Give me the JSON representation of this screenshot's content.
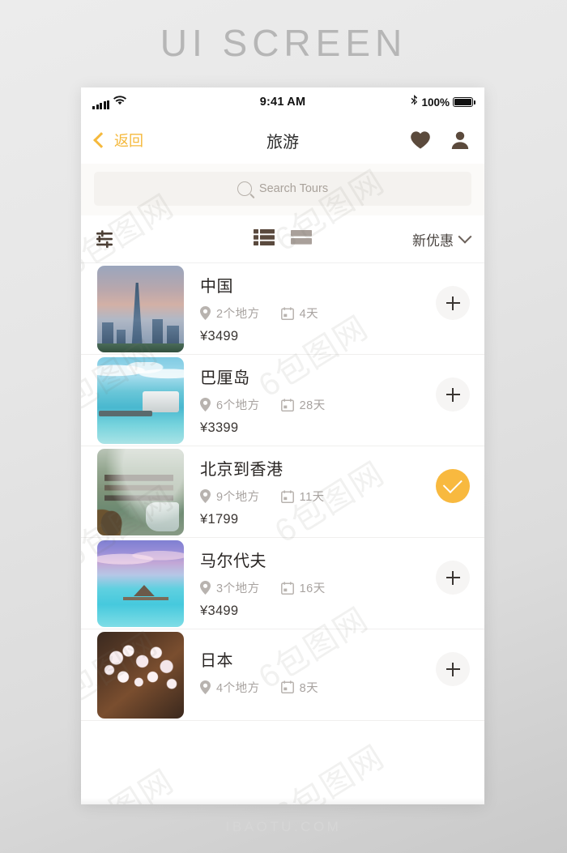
{
  "poster": {
    "title": "UI SCREEN",
    "site_watermark": "IBAOTU.COM",
    "watermark_text": "6包图网",
    "accent_color": "#f5b93c",
    "text_color": "#2a2624"
  },
  "status_bar": {
    "time": "9:41 AM",
    "battery_percent": "100%",
    "signal_icon": "signal-bars-icon",
    "wifi_icon": "wifi-icon",
    "bluetooth_icon": "bluetooth-icon",
    "battery_icon": "battery-full-icon"
  },
  "nav_bar": {
    "back_label": "返回",
    "back_icon": "chevron-left-icon",
    "title": "旅游",
    "favorite_icon": "heart-icon",
    "profile_icon": "person-icon"
  },
  "search": {
    "placeholder": "Search Tours",
    "value": "",
    "icon": "search-icon"
  },
  "filter_bar": {
    "filter_icon": "sliders-filter-icon",
    "views": [
      {
        "name": "list-view",
        "icon": "list-view-icon",
        "active": true
      },
      {
        "name": "card-view",
        "icon": "card-view-icon",
        "active": false
      }
    ],
    "sort_label": "新优惠",
    "sort_caret_icon": "chevron-down-icon"
  },
  "tours": [
    {
      "name": "中国",
      "places": "2个地方",
      "duration": "4天",
      "price": "¥3499",
      "art": "art-china",
      "selected": false,
      "action_icon": "plus-icon"
    },
    {
      "name": "巴厘岛",
      "places": "6个地方",
      "duration": "28天",
      "price": "¥3399",
      "art": "art-bali",
      "selected": false,
      "action_icon": "plus-icon"
    },
    {
      "name": "北京到香港",
      "places": "9个地方",
      "duration": "11天",
      "price": "¥1799",
      "art": "art-village",
      "selected": true,
      "action_icon": "check-icon"
    },
    {
      "name": "马尔代夫",
      "places": "3个地方",
      "duration": "16天",
      "price": "¥3499",
      "art": "art-maldives",
      "selected": false,
      "action_icon": "plus-icon"
    },
    {
      "name": "日本",
      "places": "4个地方",
      "duration": "8天",
      "price": "",
      "art": "art-japan",
      "selected": false,
      "action_icon": "plus-icon"
    }
  ],
  "icon_labels": {
    "place_pin": "map-pin-icon",
    "calendar": "calendar-icon"
  }
}
